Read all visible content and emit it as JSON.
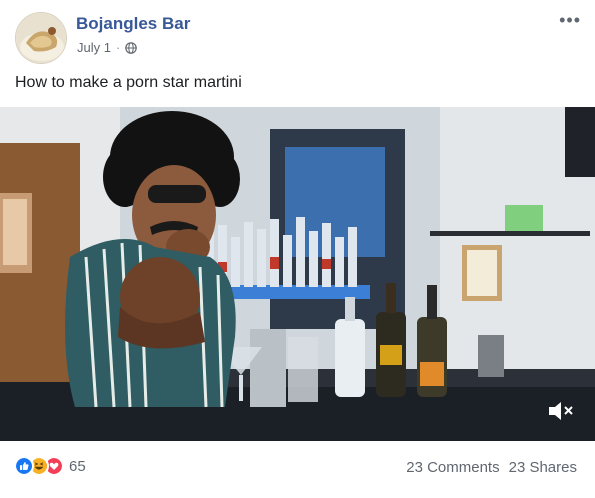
{
  "post": {
    "page_name": "Bojangles Bar",
    "date": "July 1",
    "separator": "·",
    "privacy_icon": "globe-icon",
    "more_icon": "ellipsis-icon",
    "more_label": "•••",
    "caption": "How to make a porn star martini"
  },
  "video": {
    "mute_icon": "speaker-muted-icon"
  },
  "footer": {
    "reaction_icons": [
      "like-icon",
      "haha-icon",
      "love-icon"
    ],
    "reaction_colors": [
      "#1877f2",
      "#f7b125",
      "#f33e58"
    ],
    "reaction_count": "65",
    "comments": "23 Comments",
    "shares": "23 Shares"
  }
}
